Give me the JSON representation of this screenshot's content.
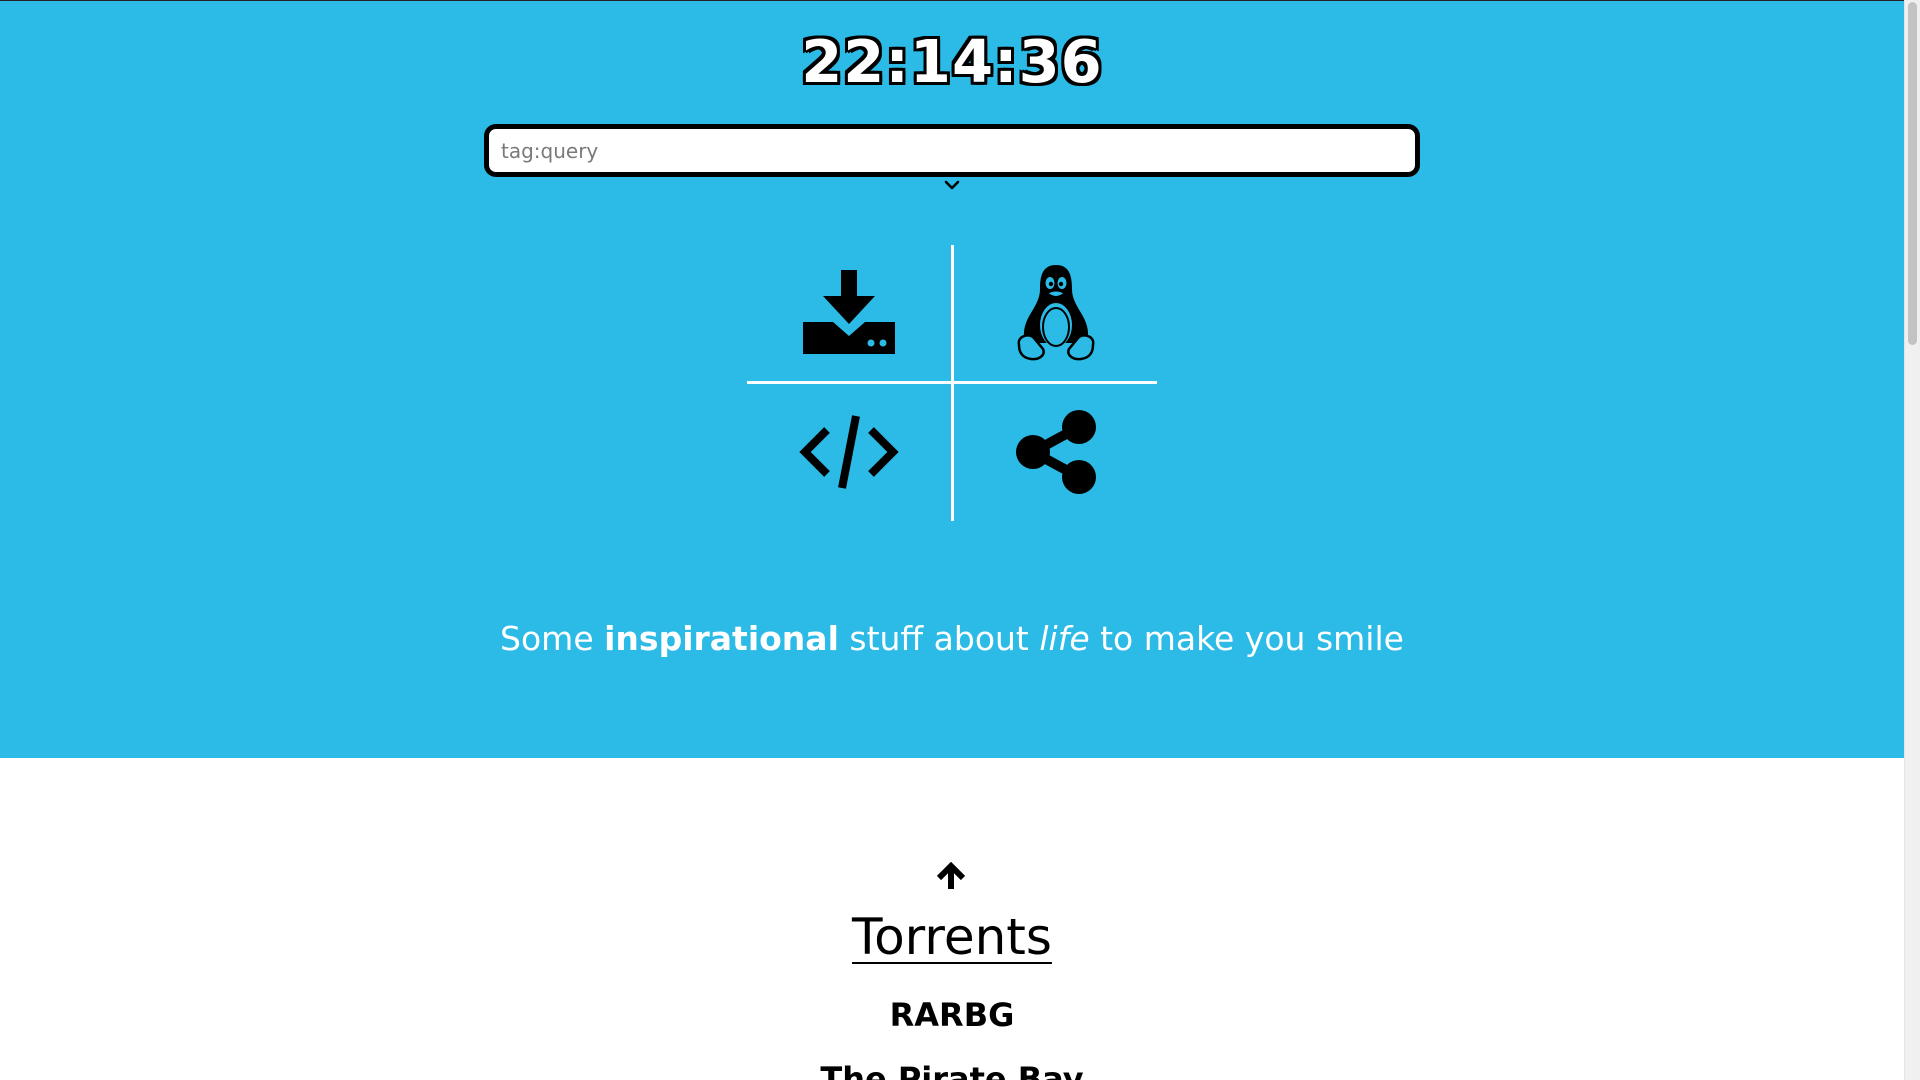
{
  "clock": {
    "time": "22:14:36"
  },
  "search": {
    "placeholder": "tag:query",
    "value": ""
  },
  "colors": {
    "hero_background": "#2cbbe6",
    "content_background": "#ffffff"
  },
  "quick_links": [
    {
      "icon": "download-server-icon"
    },
    {
      "icon": "linux-penguin-icon"
    },
    {
      "icon": "code-icon"
    },
    {
      "icon": "share-icon"
    }
  ],
  "quote": {
    "part1": "Some ",
    "bold": "inspirational",
    "part2": " stuff about ",
    "italic": "life",
    "part3": " to make you smile"
  },
  "section": {
    "back_to_top_icon": "arrow-up-icon",
    "title": "Torrents",
    "links": [
      "RARBG",
      "The Pirate Bay"
    ]
  }
}
